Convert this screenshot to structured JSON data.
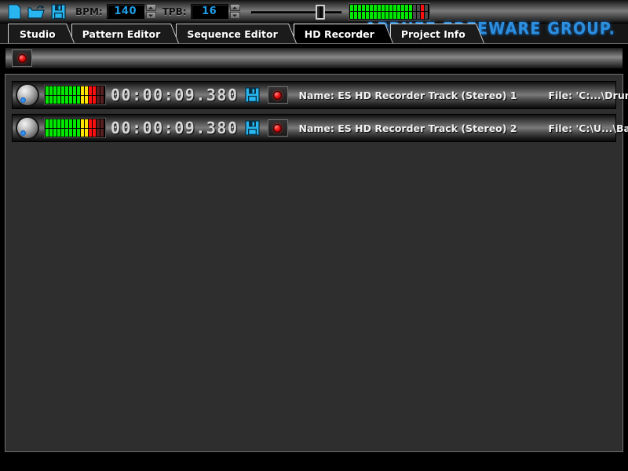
{
  "toolbar": {
    "icons": [
      {
        "name": "new-file-icon",
        "label": "New"
      },
      {
        "name": "open-folder-icon",
        "label": "Open"
      },
      {
        "name": "save-disk-icon",
        "label": "Save"
      }
    ],
    "bpm_label": "BPM:",
    "bpm_value": "140",
    "tpb_label": "TPB:",
    "tpb_value": "16",
    "master_volume_percent": 72,
    "master_meter": {
      "bars": 20,
      "lit_green": 16,
      "lit_red_index": 18,
      "colors": {
        "green": "#00e800",
        "yellow": "#ffe400",
        "red": "#ff1010",
        "dim": "#4a4a4a"
      }
    }
  },
  "tabs": [
    {
      "label": "Studio",
      "active": false
    },
    {
      "label": "Pattern Editor",
      "active": false
    },
    {
      "label": "Sequence Editor",
      "active": false
    },
    {
      "label": "HD Recorder",
      "active": true
    },
    {
      "label": "Project Info",
      "active": false
    }
  ],
  "logo": {
    "text": "APPNEE FREEWARE GROUP.",
    "color": "#2c8fe0"
  },
  "record_strip": {
    "record_button_label": "Record"
  },
  "tracks": [
    {
      "knob": "pan-knob",
      "meter": {
        "green": 9,
        "yellow": 2,
        "red_lit": 2,
        "red_dim": 2
      },
      "timecode": "00:00:09.380",
      "save_label": "Save track",
      "record_label": "Arm record",
      "name": "Name: ES HD Recorder Track (Stereo) 1",
      "file": "File: 'C:...\\Drums.wav'"
    },
    {
      "knob": "pan-knob",
      "meter": {
        "green": 9,
        "yellow": 2,
        "red_lit": 2,
        "red_dim": 2
      },
      "timecode": "00:00:09.380",
      "save_label": "Save track",
      "record_label": "Arm record",
      "name": "Name: ES HD Recorder Track (Stereo) 2",
      "file": "File: 'C:\\U...\\Bass.wav'"
    }
  ],
  "colors": {
    "accent_blue": "#1e9de8",
    "icon_cyan": "#29b6f0",
    "panel_bg": "#2e2e2e",
    "record_red": "#ef1414"
  }
}
